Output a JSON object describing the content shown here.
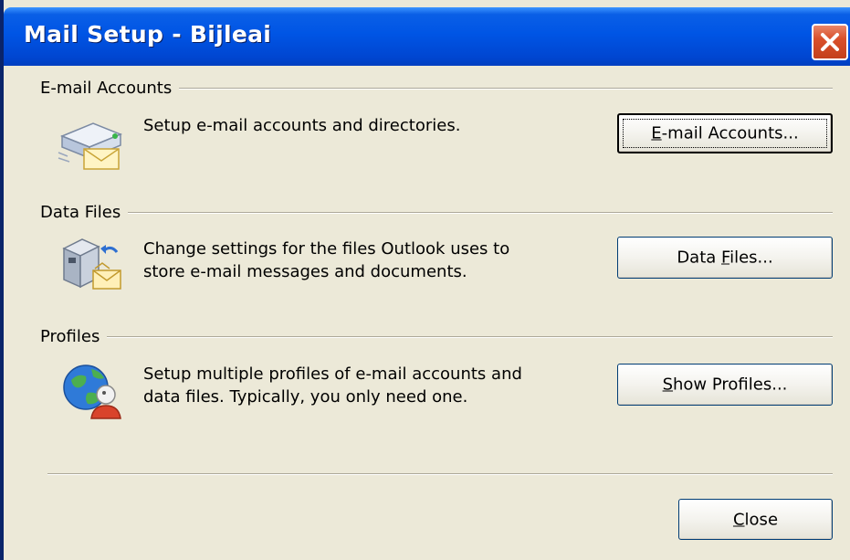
{
  "window": {
    "title": "Mail Setup - Bijleai",
    "close_icon": "close-x-icon"
  },
  "sections": {
    "email": {
      "heading": "E-mail Accounts",
      "description": "Setup e-mail accounts and directories.",
      "icon": "email-accounts-icon",
      "button": {
        "prefix": "",
        "accel": "E",
        "suffix": "-mail Accounts..."
      }
    },
    "data_files": {
      "heading": "Data Files",
      "description_line1": "Change settings for the files Outlook uses to",
      "description_line2": "store e-mail messages and documents.",
      "icon": "data-files-icon",
      "button": {
        "prefix": "Data ",
        "accel": "F",
        "suffix": "iles..."
      }
    },
    "profiles": {
      "heading": "Profiles",
      "description_line1": "Setup multiple profiles of e-mail accounts and",
      "description_line2": "data files. Typically, you only need one.",
      "icon": "profiles-icon",
      "button": {
        "prefix": "",
        "accel": "S",
        "suffix": "how Profiles..."
      }
    }
  },
  "footer": {
    "close_button": {
      "accel": "C",
      "suffix": "lose"
    }
  },
  "colors": {
    "title_bar": "#0055e5",
    "dialog_bg": "#ece9d8",
    "close_button": "#d9502b"
  }
}
